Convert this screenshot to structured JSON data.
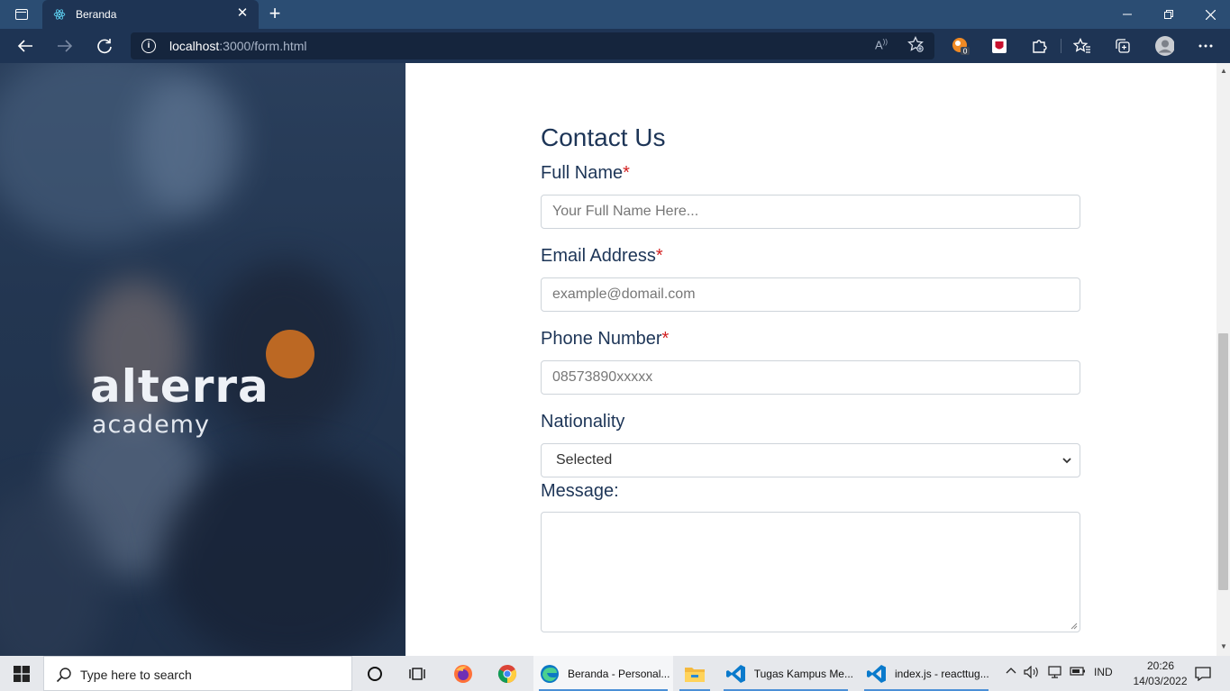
{
  "browser": {
    "tab_title": "Beranda",
    "url_host": "localhost",
    "url_path": ":3000/form.html"
  },
  "hero": {
    "logo_word": "alterra",
    "logo_sub": "academy",
    "accent_color": "#d8731f"
  },
  "form": {
    "title": "Contact Us",
    "full_name": {
      "label": "Full Name",
      "required_mark": "*",
      "placeholder": "Your Full Name Here..."
    },
    "email": {
      "label": "Email Address",
      "required_mark": "*",
      "placeholder": "example@domail.com"
    },
    "phone": {
      "label": "Phone Number",
      "required_mark": "*",
      "placeholder": "08573890xxxxx"
    },
    "nationality": {
      "label": "Nationality",
      "selected": "Selected"
    },
    "message": {
      "label": "Message:"
    }
  },
  "taskbar": {
    "search_placeholder": "Type here to search",
    "apps": [
      {
        "label": "Beranda - Personal..."
      },
      {
        "label": "Tugas Kampus Me..."
      },
      {
        "label": "index.js - reacttug..."
      }
    ],
    "language": "IND",
    "time": "20:26",
    "date": "14/03/2022"
  },
  "colors": {
    "titlebar": "#2b4d73",
    "toolbar": "#1e3454",
    "form_text": "#1d3557",
    "required": "#d21f1f"
  }
}
